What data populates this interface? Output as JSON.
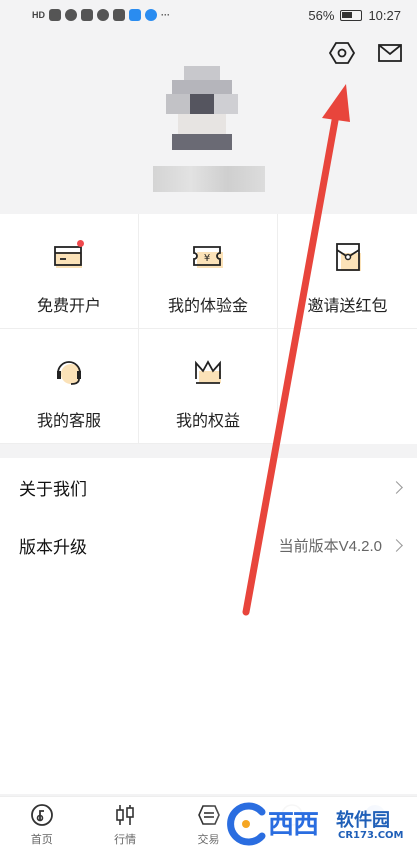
{
  "status_bar": {
    "time": "10:27",
    "battery": "56%",
    "hd_label": "HD"
  },
  "header": {
    "settings_icon": "settings-hexagon-icon",
    "message_icon": "envelope-icon"
  },
  "grid": {
    "items": [
      {
        "label": "免费开户",
        "icon": "card-icon",
        "badge": true
      },
      {
        "label": "我的体验金",
        "icon": "yen-ticket-icon"
      },
      {
        "label": "邀请送红包",
        "icon": "red-envelope-icon"
      },
      {
        "label": "我的客服",
        "icon": "headset-icon"
      },
      {
        "label": "我的权益",
        "icon": "crown-icon"
      }
    ]
  },
  "list": {
    "about": {
      "label": "关于我们"
    },
    "version": {
      "label": "版本升级",
      "value": "当前版本V4.2.0"
    }
  },
  "tabbar": {
    "tabs": [
      {
        "label": "首页",
        "icon": "home-disc-icon"
      },
      {
        "label": "行情",
        "icon": "candlestick-icon"
      },
      {
        "label": "交易",
        "icon": "exchange-icon"
      },
      {
        "label": "",
        "icon": "discover-icon"
      },
      {
        "label": "",
        "icon": "profile-icon"
      }
    ]
  },
  "watermark": {
    "brand": "西西",
    "brand2": "软件园",
    "domain": "CR173.COM"
  },
  "colors": {
    "accent_blue": "#2a6de0",
    "annotation_red": "#e8453c",
    "icon_gold": "#f5c46a",
    "badge_red": "#f0494d"
  }
}
